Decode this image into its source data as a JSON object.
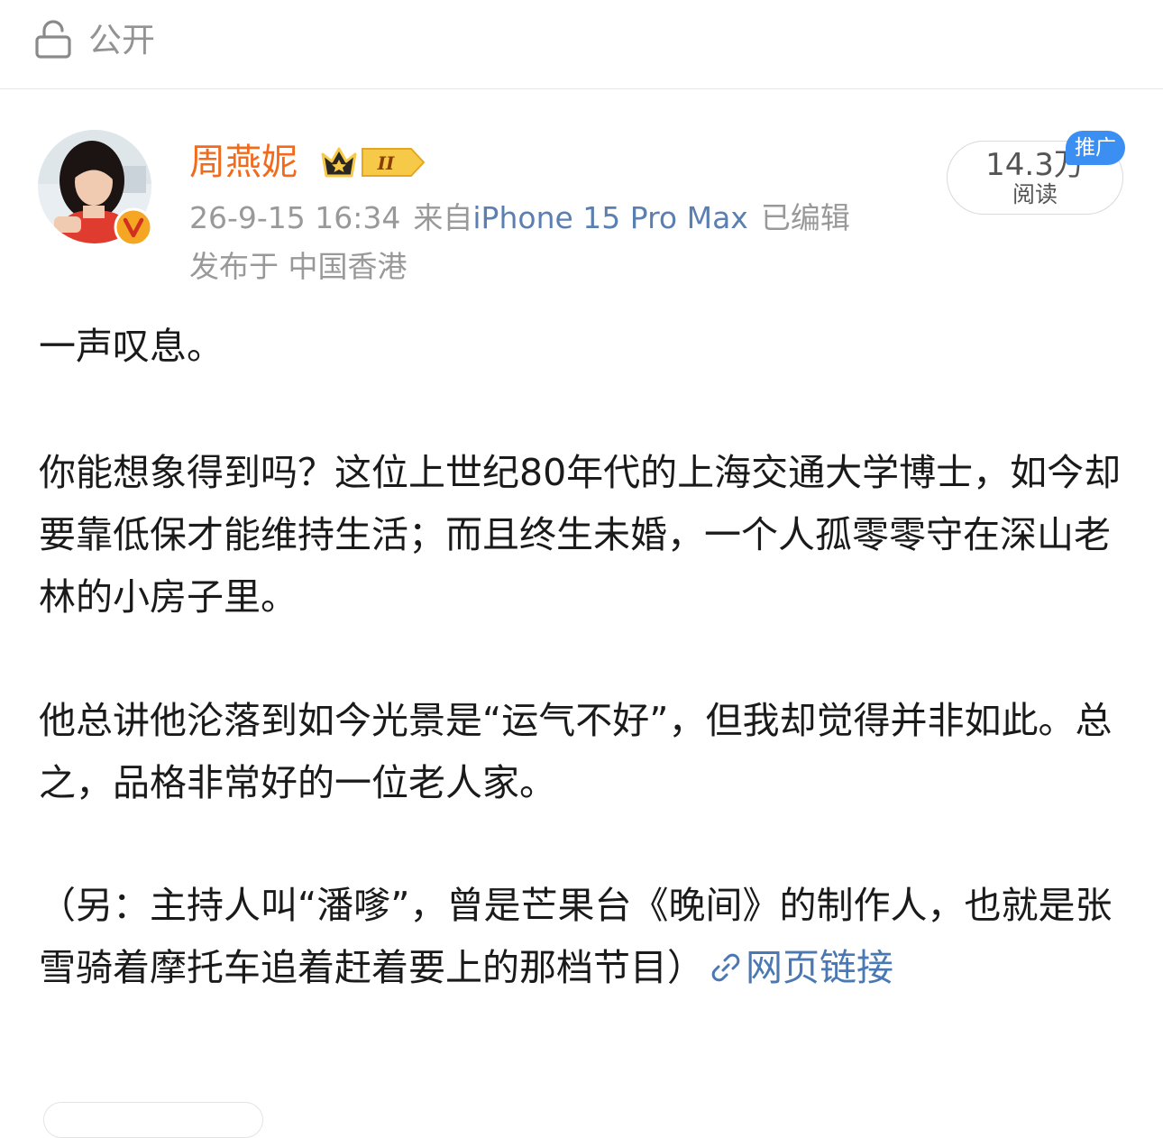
{
  "top_bar": {
    "visibility_icon": "lock-open-icon",
    "visibility_label": "公开"
  },
  "author": {
    "name": "周燕妮",
    "avatar": "avatar-photo",
    "verified_icon": "verified-v-icon",
    "member_badge_icon": "crown-level-badge-icon",
    "member_badge_text": "II",
    "colors": {
      "name": "#f26b1d",
      "verified": "#f5a623"
    }
  },
  "meta": {
    "timestamp": "26-9-15 16:34",
    "source_prefix": "来自",
    "device": "iPhone 15 Pro Max",
    "edited": "已编辑",
    "location": "发布于 中国香港"
  },
  "stats": {
    "read_count": "14.3万",
    "read_label": "阅读",
    "promo_tag": "推广"
  },
  "post": {
    "paragraphs": [
      "一声叹息。",
      "你能想象得到吗？这位上世纪80年代的上海交通大学博士，如今却要靠低保才能维持生活；而且终生未婚，一个人孤零零守在深山老林的小房子里。",
      "他总讲他沦落到如今光景是“运气不好”，但我却觉得并非如此。总之，品格非常好的一位老人家。",
      "（另：主持人叫“潘嗲”，曾是芒果台《晚间》的制作人，也就是张雪骑着摩托车追着赶着要上的那档节目）"
    ],
    "link_icon": "link-icon",
    "link_text": "网页链接",
    "colors": {
      "link": "#4a78b2"
    }
  }
}
